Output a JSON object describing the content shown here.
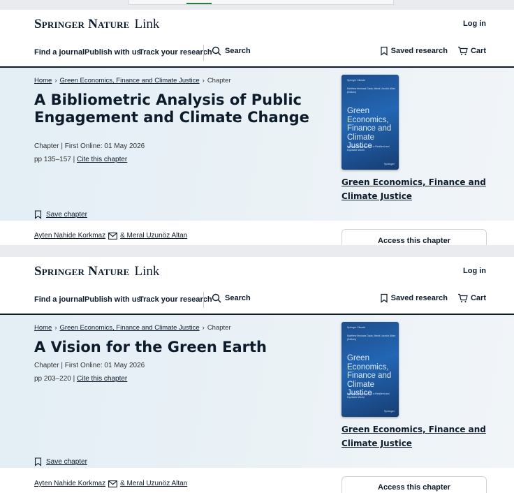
{
  "brand": {
    "name": "Springer Nature",
    "product": "Link"
  },
  "header": {
    "login_label": "Log in"
  },
  "nav": {
    "find_journal": "Find a journal",
    "publish": "Publish with us",
    "track": "Track your research",
    "search": "Search",
    "saved_research": "Saved research",
    "cart": "Cart"
  },
  "pages": [
    {
      "breadcrumb": {
        "home": "Home",
        "book": "Green Economics, Finance and Climate Justice",
        "current": "Chapter"
      },
      "title": "A Bibliometric Analysis of Public Engagement and Climate Change",
      "meta_line": "Chapter | First Online: 01 May 2026",
      "pages_text": "pp 135–157 |",
      "cite_label": "Cite this chapter",
      "save_label": "Save chapter",
      "book_title": "Green Economics, Finance and Climate Justice",
      "author1": "Ayten Nahide Korkmaz",
      "author2": "& Meral Uzunöz Altan",
      "access_label": "Access this chapter"
    },
    {
      "breadcrumb": {
        "home": "Home",
        "book": "Green Economics, Finance and Climate Justice",
        "current": "Chapter"
      },
      "title": "A Vision for the Green Earth",
      "meta_line": "Chapter | First Online: 01 May 2026",
      "pages_text": "pp 203–220 |",
      "cite_label": "Cite this chapter",
      "save_label": "Save chapter",
      "book_title": "Green Economics, Finance and Climate Justice",
      "author1": "Ayten Nahide Korkmaz",
      "author2": "& Meral Uzunöz Altan",
      "access_label": "Access this chapter"
    }
  ],
  "cover": {
    "series": "Springer Climate",
    "editors": "Matthew Ifeoluwa Dada, Meral Uzunöz Altan (Editors)",
    "title": "Green Economics, Finance and Climate Justice",
    "subtitle": "Innovative Solutions for a Resilient and Equitable World",
    "publisher": "Springer"
  }
}
